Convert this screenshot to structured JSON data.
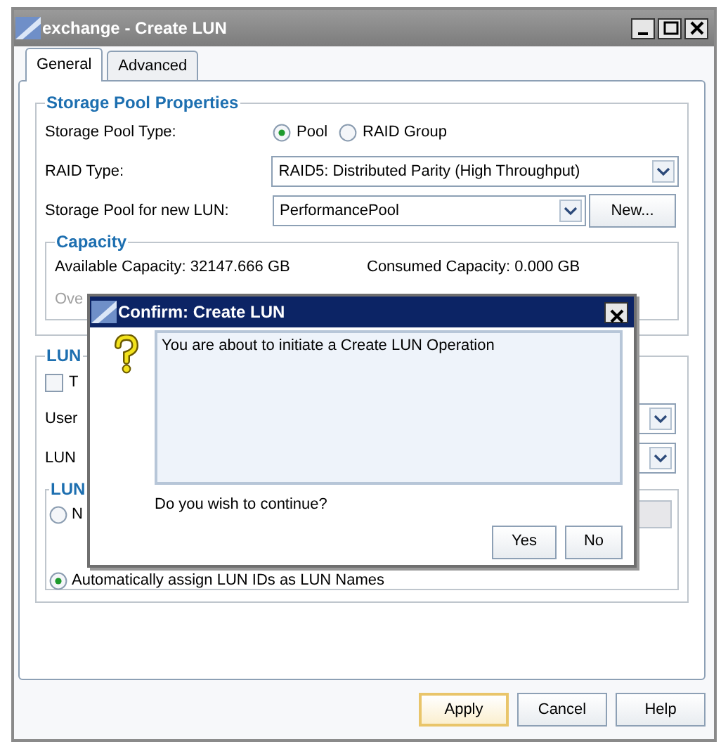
{
  "window": {
    "title": "exchange - Create LUN"
  },
  "tabs": [
    {
      "label": "General",
      "selected": true
    },
    {
      "label": "Advanced",
      "selected": false
    }
  ],
  "storage_pool_properties": {
    "title": "Storage Pool Properties",
    "pool_type_label": "Storage Pool Type:",
    "pool_type_options": [
      {
        "label": "Pool",
        "selected": true
      },
      {
        "label": "RAID Group",
        "selected": false
      }
    ],
    "raid_type_label": "RAID Type:",
    "raid_type_value": "RAID5: Distributed Parity (High Throughput)",
    "pool_label": "Storage Pool for new LUN:",
    "pool_value": "PerformancePool",
    "new_button": "New...",
    "capacity": {
      "title": "Capacity",
      "available": "Available Capacity: 32147.666 GB",
      "consumed": "Consumed Capacity: 0.000 GB",
      "partial_label": "Ove"
    }
  },
  "lun_properties": {
    "title": "LUN",
    "checkbox": {
      "label": "T",
      "checked": false
    },
    "user_label": "User",
    "lun_label": "LUN",
    "name_group": {
      "title": "LUN",
      "options": [
        {
          "label": "N",
          "selected": false
        },
        {
          "label": "Automatically assign LUN IDs as LUN Names",
          "selected": true
        }
      ]
    }
  },
  "buttons": [
    {
      "label": "Apply",
      "default": true
    },
    {
      "label": "Cancel",
      "default": false
    },
    {
      "label": "Help",
      "default": false
    }
  ],
  "dialog": {
    "title": "Confirm: Create LUN",
    "message": "You are about to initiate a Create LUN Operation",
    "question": "Do you wish to continue?",
    "buttons": [
      "Yes",
      "No"
    ]
  }
}
